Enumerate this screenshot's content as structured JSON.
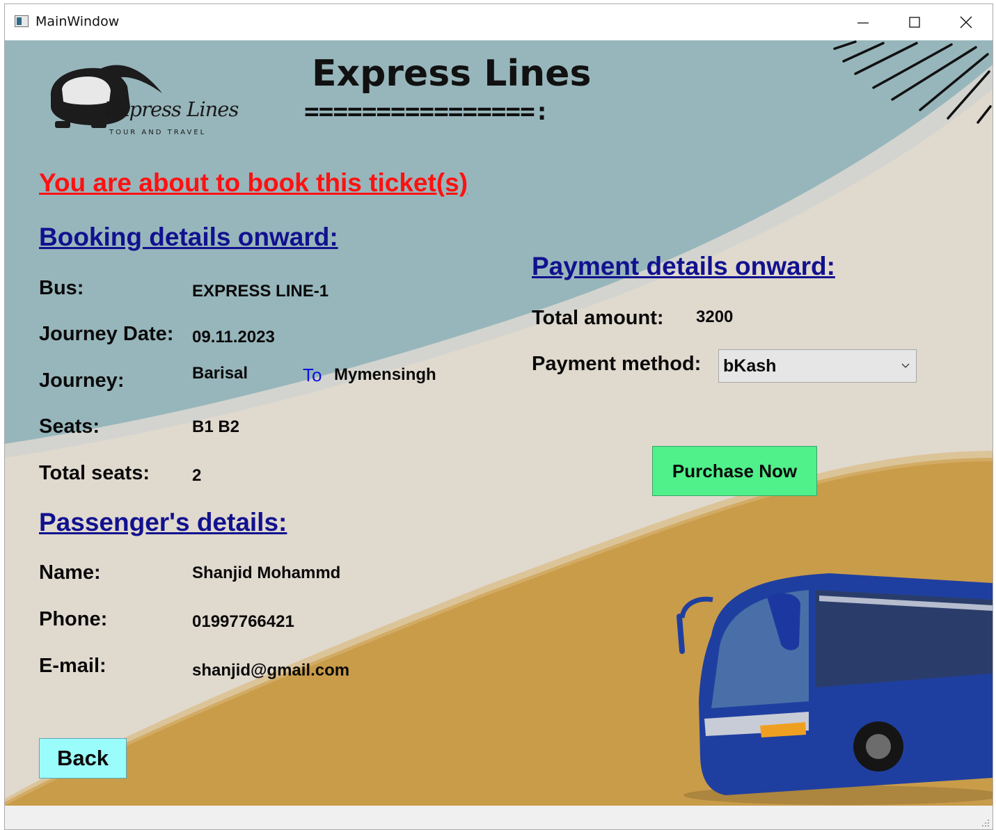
{
  "window": {
    "title": "MainWindow",
    "controls": [
      "minimize",
      "maximize",
      "close"
    ]
  },
  "brand": {
    "logo_text": "Express Lines",
    "logo_subtext": "TOUR AND TRAVEL",
    "app_title": "Express Lines",
    "title_rule": "================:"
  },
  "warning": "You are about to book this ticket(s)",
  "booking": {
    "heading": "Booking details onward:",
    "bus_label": "Bus:",
    "bus_value": "EXPRESS LINE-1",
    "date_label": "Journey Date:",
    "date_value": "09.11.2023",
    "journey_label": "Journey:",
    "from": "Barisal",
    "to_label": "To",
    "to": "Mymensingh",
    "seats_label": "Seats:",
    "seats_value": "B1 B2",
    "total_seats_label": "Total seats:",
    "total_seats_value": "2"
  },
  "passenger": {
    "heading": "Passenger's details:",
    "name_label": "Name:",
    "name_value": "Shanjid Mohammd",
    "phone_label": "Phone:",
    "phone_value": "01997766421",
    "email_label": "E-mail:",
    "email_value": "shanjid@gmail.com"
  },
  "payment": {
    "heading": "Payment details onward:",
    "total_label": "Total amount:",
    "total_value": "3200",
    "method_label": "Payment method:",
    "method_selected": "bKash"
  },
  "buttons": {
    "purchase": "Purchase Now",
    "back": "Back"
  },
  "colors": {
    "sky": "#97b6bb",
    "sand": "#e0d9ce",
    "gold": "#c99c49",
    "warning": "#ff1111",
    "heading": "#11118f",
    "purchase_button": "#50f08a",
    "back_button": "#9bfcfc"
  },
  "icons": {
    "minimize": "minimize-icon",
    "maximize": "maximize-icon",
    "close": "close-icon",
    "dropdown": "chevron-down-icon"
  }
}
